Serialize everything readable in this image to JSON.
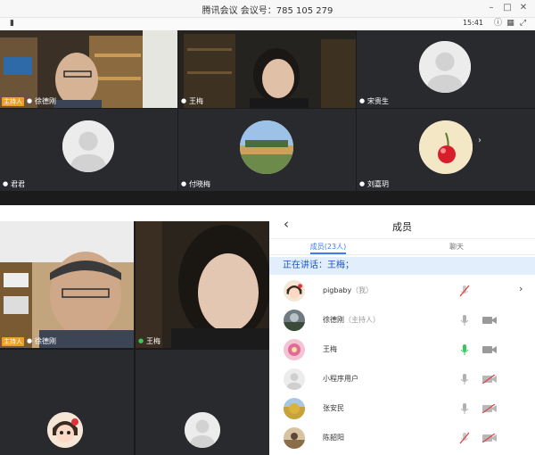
{
  "window": {
    "title": "腾讯会议  会议号：785 105 279",
    "clock": "15:41"
  },
  "tiles_top": [
    {
      "name": "徐德刚",
      "host_tag": "主持人",
      "type": "video"
    },
    {
      "name": "王梅",
      "type": "video"
    },
    {
      "name": "宋贵生",
      "type": "avatar"
    },
    {
      "name": "君君",
      "type": "avatar"
    },
    {
      "name": "付晓梅",
      "type": "landscape"
    },
    {
      "name": "刘嘉玥",
      "type": "cherry"
    }
  ],
  "tiles_bottom": [
    {
      "name": "徐德刚",
      "host_tag": "主持人"
    },
    {
      "name": "王梅"
    }
  ],
  "members_panel": {
    "back_icon": "back-chevron-icon",
    "title": "成员",
    "tabs": [
      {
        "label": "成员(23人)",
        "active": true
      },
      {
        "label": "聊天",
        "active": false
      }
    ],
    "speaking": "正在讲话：王梅；",
    "members": [
      {
        "name": "pigbaby",
        "role": "（我）",
        "mic": "muted",
        "cam": "none",
        "chevron": true
      },
      {
        "name": "徐德刚",
        "role": "（主持人）",
        "mic": "on",
        "cam": "on"
      },
      {
        "name": "王梅",
        "role": "",
        "mic": "active",
        "cam": "on"
      },
      {
        "name": "小程序用户",
        "role": "",
        "mic": "on",
        "cam": "off"
      },
      {
        "name": "张安民",
        "role": "",
        "mic": "on",
        "cam": "off"
      },
      {
        "name": "陈韶阳",
        "role": "",
        "mic": "muted",
        "cam": "off"
      }
    ]
  },
  "colors": {
    "accent": "#3a7ef0",
    "host_tag": "#f0a020",
    "speaking_bg": "#e3eefc",
    "mic_active": "#36c85a",
    "muted": "#e04040"
  }
}
